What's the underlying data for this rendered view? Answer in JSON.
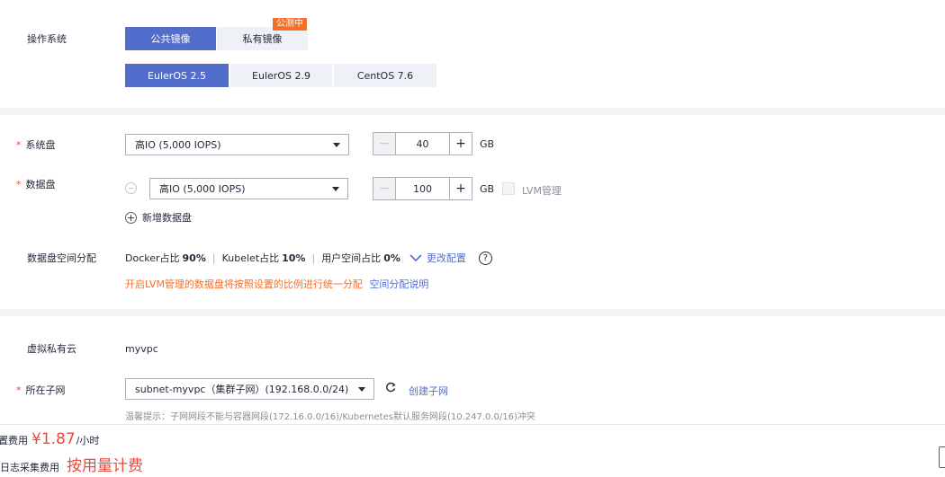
{
  "os": {
    "label": "操作系统",
    "image_tabs": [
      {
        "label": "公共镜像",
        "active": true
      },
      {
        "label": "私有镜像",
        "active": false
      }
    ],
    "private_badge": "公测中",
    "versions": [
      {
        "label": "EulerOS 2.5",
        "active": true
      },
      {
        "label": "EulerOS 2.9",
        "active": false
      },
      {
        "label": "CentOS 7.6",
        "active": false
      }
    ]
  },
  "disk": {
    "system_label": "系统盘",
    "system_type": "高IO (5,000 IOPS)",
    "system_size": "40",
    "unit": "GB",
    "data_label": "数据盘",
    "data_type": "高IO (5,000 IOPS)",
    "data_size": "100",
    "lvm_label": "LVM管理",
    "add_data_disk": "新增数据盘",
    "alloc_label": "数据盘空间分配",
    "alloc": {
      "docker_label": "Docker占比",
      "docker_value": "90%",
      "kubelet_label": "Kubelet占比",
      "kubelet_value": "10%",
      "user_label": "用户空间占比",
      "user_value": "0%",
      "change_config": "更改配置"
    },
    "lvm_note": "开启LVM管理的数据盘将按照设置的比例进行统一分配",
    "alloc_help_link": "空间分配说明"
  },
  "network": {
    "vpc_label": "虚拟私有云",
    "vpc_value": "myvpc",
    "subnet_label": "所在子网",
    "subnet_value": "subnet-myvpc（集群子网）(192.168.0.0/24)",
    "create_subnet": "创建子网",
    "tip": "温馨提示：子网网段不能与容器网段(172.16.0.0/16)/Kubernetes默认服务网段(10.247.0.0/16)冲突"
  },
  "footer": {
    "config_fee_label": "置费用",
    "price": "¥1.87",
    "price_unit": "/小时",
    "log_fee_label": "日志采集费用",
    "log_fee_value": "按用量计费"
  },
  "colors": {
    "accent": "#526ecc",
    "warning": "#f66f28",
    "required": "#e84a3d",
    "price": "#e84a3d"
  }
}
